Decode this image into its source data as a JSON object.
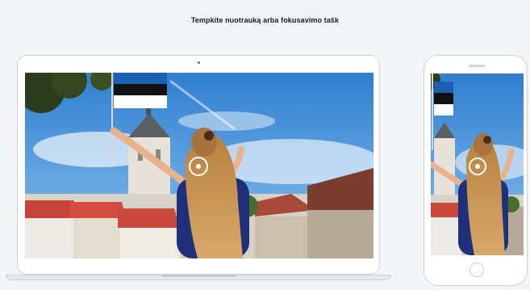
{
  "instruction": "Tempkite nuotrauką arba fokusavimo tašk",
  "devices": {
    "laptop": {
      "name": "laptop-preview"
    },
    "phone": {
      "name": "phone-preview"
    }
  },
  "photo": {
    "description_icon": "city-photo",
    "focus_icon": "focus-point-icon",
    "sky_color": "#3f8fd6",
    "flag_colors": [
      "#1b5fb5",
      "#111111",
      "#ffffff"
    ]
  }
}
